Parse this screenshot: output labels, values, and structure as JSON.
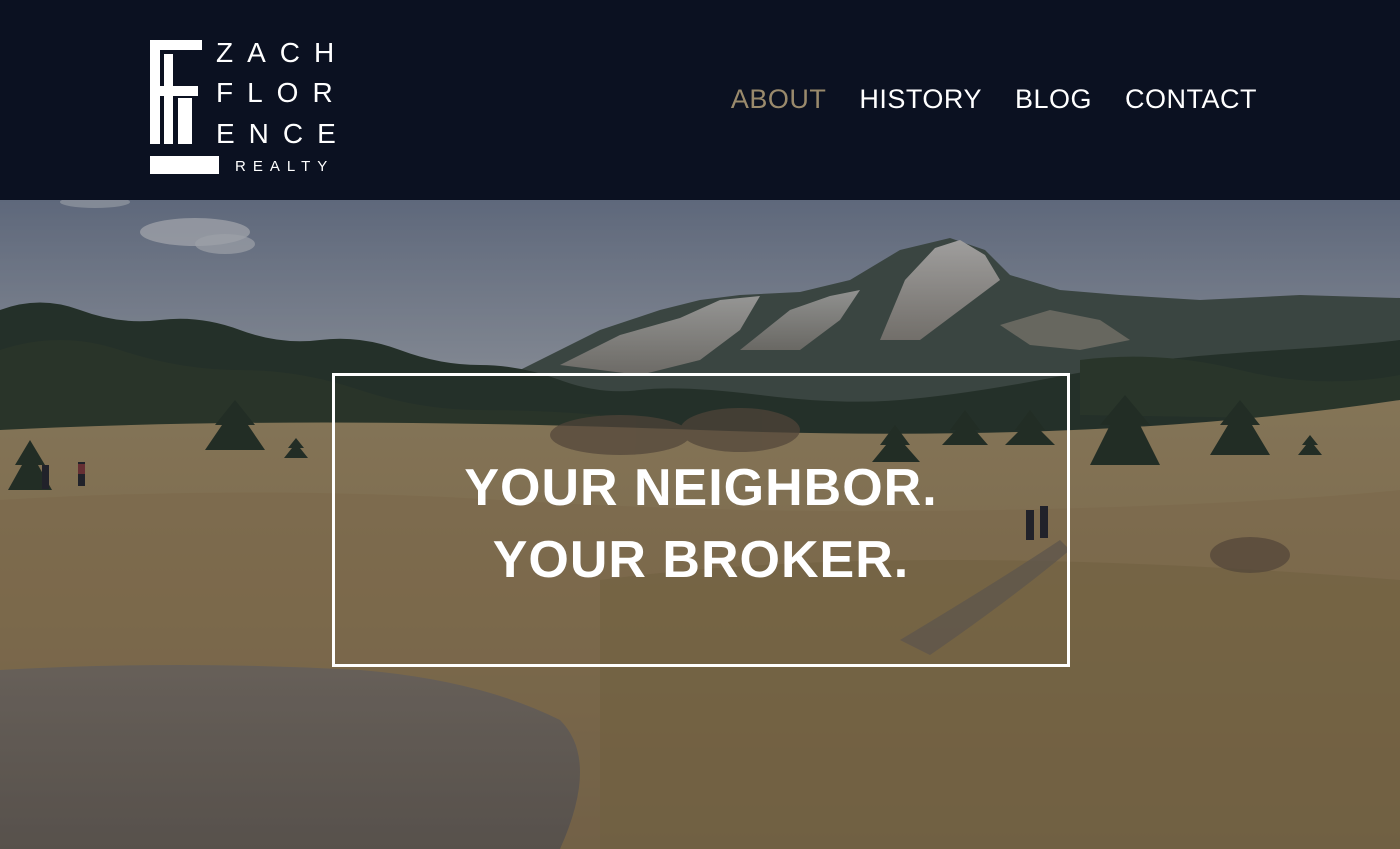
{
  "brand": {
    "name_lines": [
      "ZACH",
      "FLOR",
      "ENCE"
    ],
    "subtitle": "REALTY",
    "logo_icon": "building-f-logo-icon",
    "color": "#ffffff"
  },
  "nav": {
    "items": [
      {
        "label": "ABOUT",
        "active": true
      },
      {
        "label": "HISTORY",
        "active": false
      },
      {
        "label": "BLOG",
        "active": false
      },
      {
        "label": "CONTACT",
        "active": false
      }
    ],
    "active_color": "#9a8a6c",
    "text_color": "#ffffff"
  },
  "header": {
    "background": "#0b1121"
  },
  "hero": {
    "line1": "YOUR NEIGHBOR.",
    "line2": "YOUR BROKER.",
    "image_subject": "mountain-meadow-hiking-trail"
  }
}
